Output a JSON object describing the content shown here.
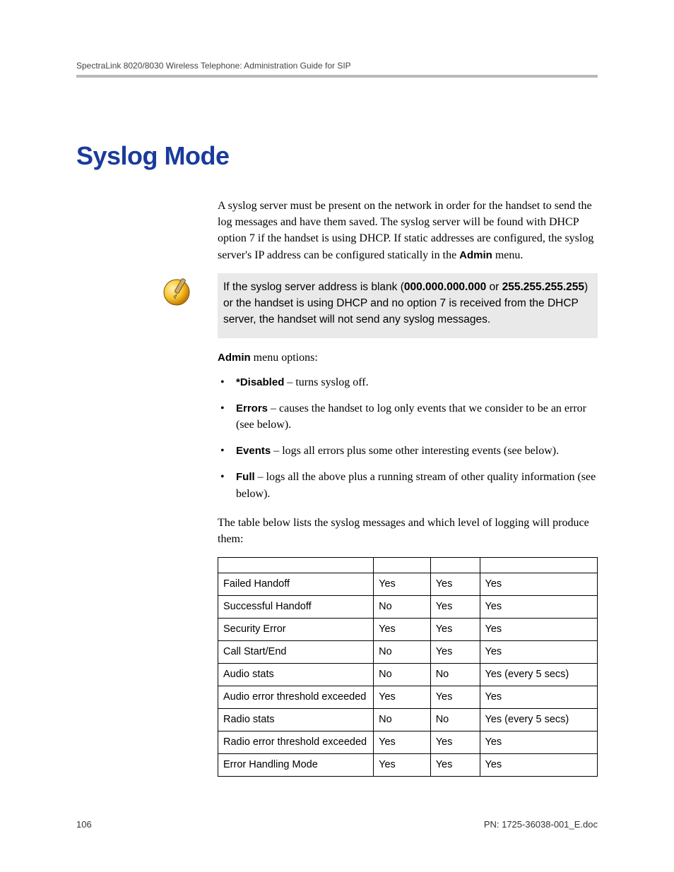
{
  "header": {
    "text": "SpectraLink 8020/8030 Wireless Telephone: Administration Guide for SIP"
  },
  "title": "Syslog Mode",
  "intro": {
    "p1_part1": "A syslog server must be present on the network in order for the handset to send the log messages and have them saved. The syslog server will be found with DHCP option 7 if the handset is using DHCP. If static addresses are configured, the syslog server's IP address can be configured statically in the ",
    "p1_bold1": "Admin",
    "p1_part2": " menu."
  },
  "note": {
    "part1": "If the syslog server address is blank (",
    "bold1": "000.000.000.000",
    "part2": " or ",
    "bold2": "255.255.255.255",
    "part3": ") or the handset is using DHCP and no option 7 is received from the DHCP server, the handset will not send any syslog messages."
  },
  "admin_line": {
    "bold": "Admin",
    "rest": " menu options:"
  },
  "options": [
    {
      "bold": "*Disabled",
      "rest": " – turns syslog off."
    },
    {
      "bold": "Errors",
      "rest": " – causes the handset to log only events that we consider to be an error (see below)."
    },
    {
      "bold": "Events",
      "rest": " – logs all errors plus some other interesting events (see below)."
    },
    {
      "bold": "Full",
      "rest": " – logs all the above plus a running stream of other quality information (see below)."
    }
  ],
  "table_intro": "The table below lists the syslog messages and which level of logging will produce them:",
  "chart_data": {
    "type": "table",
    "columns": [
      "",
      "",
      "",
      ""
    ],
    "rows": [
      [
        "Failed Handoff",
        "Yes",
        "Yes",
        "Yes"
      ],
      [
        "Successful Handoff",
        "No",
        "Yes",
        "Yes"
      ],
      [
        "Security Error",
        "Yes",
        "Yes",
        "Yes"
      ],
      [
        "Call Start/End",
        "No",
        "Yes",
        "Yes"
      ],
      [
        "Audio stats",
        "No",
        "No",
        "Yes (every 5 secs)"
      ],
      [
        "Audio error threshold exceeded",
        "Yes",
        "Yes",
        "Yes"
      ],
      [
        "Radio stats",
        "No",
        "No",
        "Yes (every 5 secs)"
      ],
      [
        "Radio error threshold exceeded",
        "Yes",
        "Yes",
        "Yes"
      ],
      [
        "Error Handling Mode",
        "Yes",
        "Yes",
        "Yes"
      ]
    ]
  },
  "footer": {
    "page": "106",
    "pn": "PN: 1725-36038-001_E.doc"
  }
}
